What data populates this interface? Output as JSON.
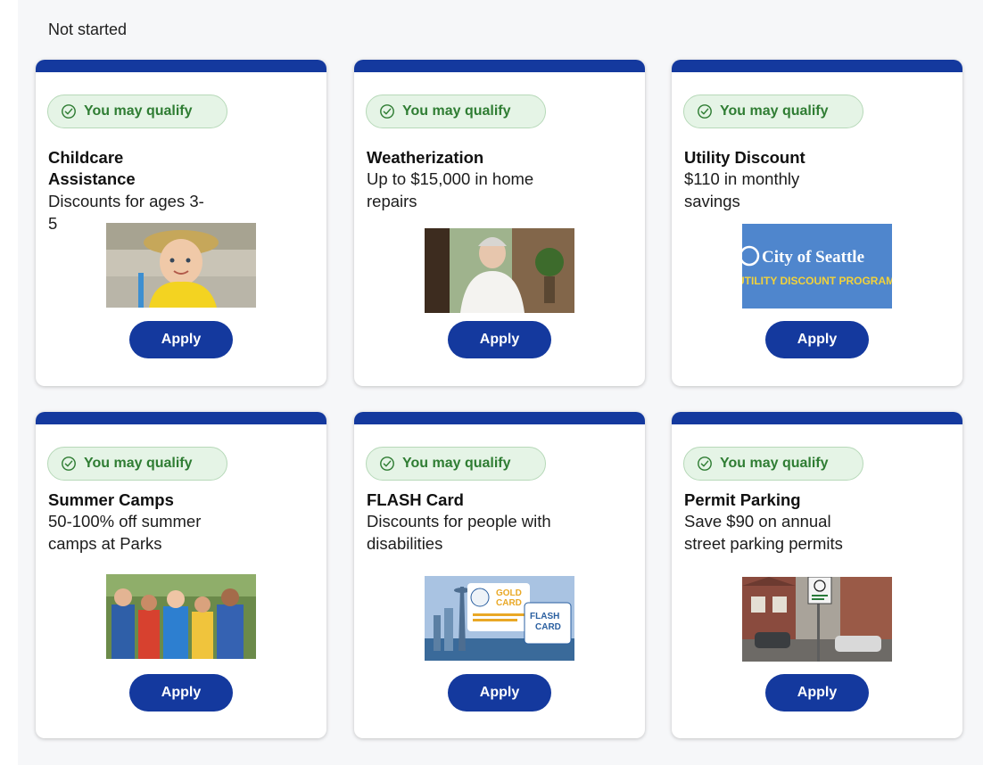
{
  "section": {
    "title": "Not started"
  },
  "badge_label": "You may qualify",
  "apply_label": "Apply",
  "colors": {
    "primary": "#14399e",
    "badge_bg": "#e5f4e6",
    "badge_text": "#2f7d33"
  },
  "cards": [
    {
      "title": "Childcare Assistance",
      "description": "Discounts for ages 3-5",
      "image": "child-in-yellow-shirt-photo"
    },
    {
      "title": "Weatherization",
      "description": "Up to $15,000 in home repairs",
      "image": "older-woman-at-home-photo"
    },
    {
      "title": "Utility Discount",
      "description": "$110 in monthly savings",
      "image": "city-of-seattle-utility-discount-logo",
      "image_text": {
        "line1": "City of Seattle",
        "line2": "UTILITY DISCOUNT PROGRAM"
      }
    },
    {
      "title": "Summer Camps",
      "description": "50-100% off summer camps at Parks",
      "image": "kids-at-summer-camp-photo"
    },
    {
      "title": "FLASH Card",
      "description": "Discounts for people with disabilities",
      "image": "flash-card-seattle-skyline-image",
      "image_text": {
        "gold": "GOLD",
        "card": "CARD",
        "flash": "FLASH",
        "card2": "CARD"
      }
    },
    {
      "title": "Permit Parking",
      "description": "Save $90 on annual street parking permits",
      "image": "street-parking-sign-photo"
    }
  ]
}
